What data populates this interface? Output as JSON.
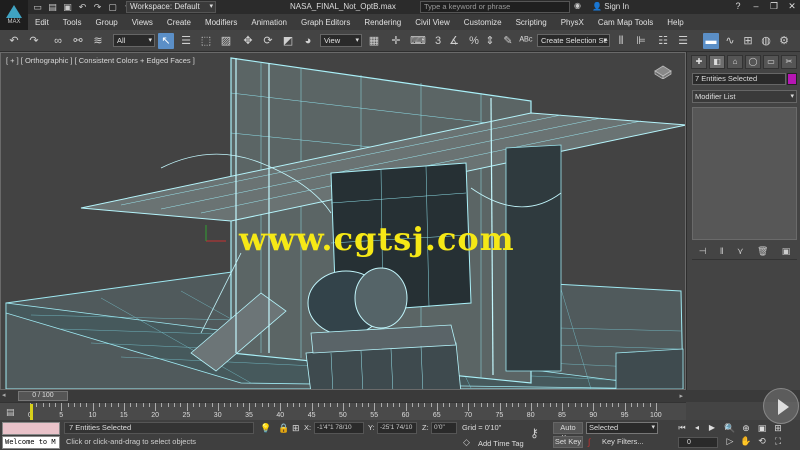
{
  "titlebar": {
    "app_logo_text": "MAX",
    "workspace": "Workspace: Default",
    "file_title": "NASA_FINAL_Not_OptB.max",
    "search_placeholder": "Type a keyword or phrase",
    "sign_in": "Sign In"
  },
  "menu": [
    "Edit",
    "Tools",
    "Group",
    "Views",
    "Create",
    "Modifiers",
    "Animation",
    "Graph Editors",
    "Rendering",
    "Civil View",
    "Customize",
    "Scripting",
    "PhysX",
    "Cam Map Tools",
    "Help"
  ],
  "toolbar": {
    "selection_filter": "All",
    "reference_coord": "View",
    "named_selection": "Create Selection Se",
    "snap_angle": "3",
    "percent_snap": "%"
  },
  "viewport": {
    "label": "[ + ] [ Orthographic ] [ Consistent Colors + Edged Faces ]",
    "watermark": "www.cgtsj.com"
  },
  "command_panel": {
    "selection_name": "7 Entities Selected",
    "selection_color": "#b516b3",
    "modifier_list": "Modifier List"
  },
  "timeline": {
    "frame_indicator": "0 / 100",
    "current_frame": 0,
    "total_frames": 100,
    "ruler_numbers": [
      "0",
      "5",
      "10",
      "15",
      "20",
      "25",
      "30",
      "35",
      "40",
      "45",
      "50",
      "55",
      "60",
      "65",
      "70",
      "75",
      "80",
      "85",
      "90",
      "95",
      "100"
    ]
  },
  "status": {
    "maxscript_output": "Welcome to M",
    "selection_status": "7 Entities Selected",
    "prompt": "Click or click-and-drag to select objects",
    "x_label": "X:",
    "x_value": "-1'4\"1 78/10",
    "y_label": "Y:",
    "y_value": "-25'1 74/10",
    "z_label": "Z:",
    "z_value": "0'0\"",
    "grid": "Grid = 0'10\"",
    "add_time_tag": "Add Time Tag",
    "auto_key": "Auto Key",
    "set_key": "Set Key",
    "key_mode": "Selected",
    "key_filters": "Key Filters...",
    "frame_value": "0"
  }
}
